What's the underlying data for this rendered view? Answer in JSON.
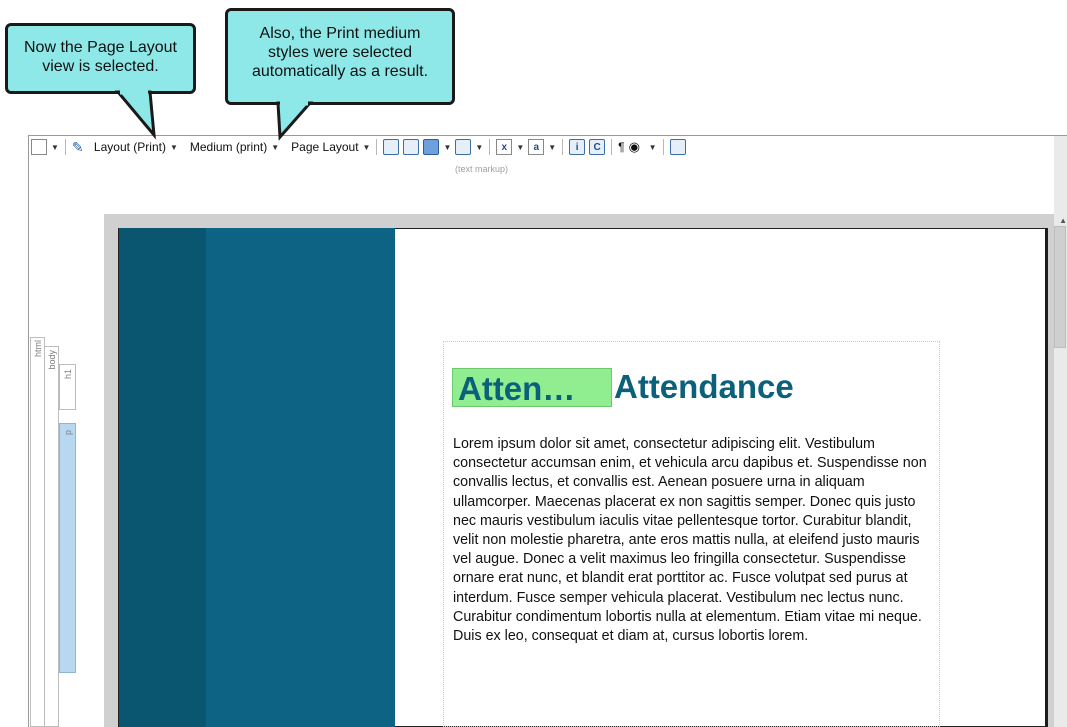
{
  "callouts": {
    "left": [
      "Now the Page Layout",
      "view is selected."
    ],
    "right": [
      "Also, the Print medium",
      "styles were selected",
      "automatically as a result."
    ]
  },
  "toolbar": {
    "layout_label": "Layout (Print)",
    "medium_label": "Medium (print)",
    "view_label": "Page Layout",
    "markup_label": "(text markup)",
    "pilcrow": "¶"
  },
  "structure_bars": {
    "html": "html",
    "body": "body",
    "h1": "h1",
    "p": "p"
  },
  "document": {
    "variable_chip": "Atten…",
    "heading": "Attendance",
    "paragraph": "Lorem ipsum dolor sit amet, consectetur adipiscing elit. Vestibulum consectetur accumsan enim, et vehicula arcu dapibus et. Suspendisse non convallis lectus, et convallis est. Aenean posuere urna in aliquam ullamcorper. Maecenas placerat ex non sagittis semper. Donec quis justo nec mauris vestibulum iaculis vitae pellentesque tortor. Curabitur blandit, velit non molestie pharetra, ante eros mattis nulla, at eleifend justo mauris vel augue. Donec a velit maximus leo fringilla consectetur. Suspendisse ornare erat nunc, et blandit erat porttitor ac. Fusce volutpat sed purus at interdum. Fusce semper vehicula placerat. Vestibulum nec lectus nunc. Curabitur condimentum lobortis nulla at elementum. Etiam vitae mi neque. Duis ex leo, consequat et diam at, cursus lobortis lorem."
  },
  "colors": {
    "callout_fill": "#8ee8e8",
    "heading": "#0c617a",
    "sidebar_dark": "#0a5670",
    "sidebar_mid": "#0d6383",
    "variable_highlight": "#90ee90"
  }
}
